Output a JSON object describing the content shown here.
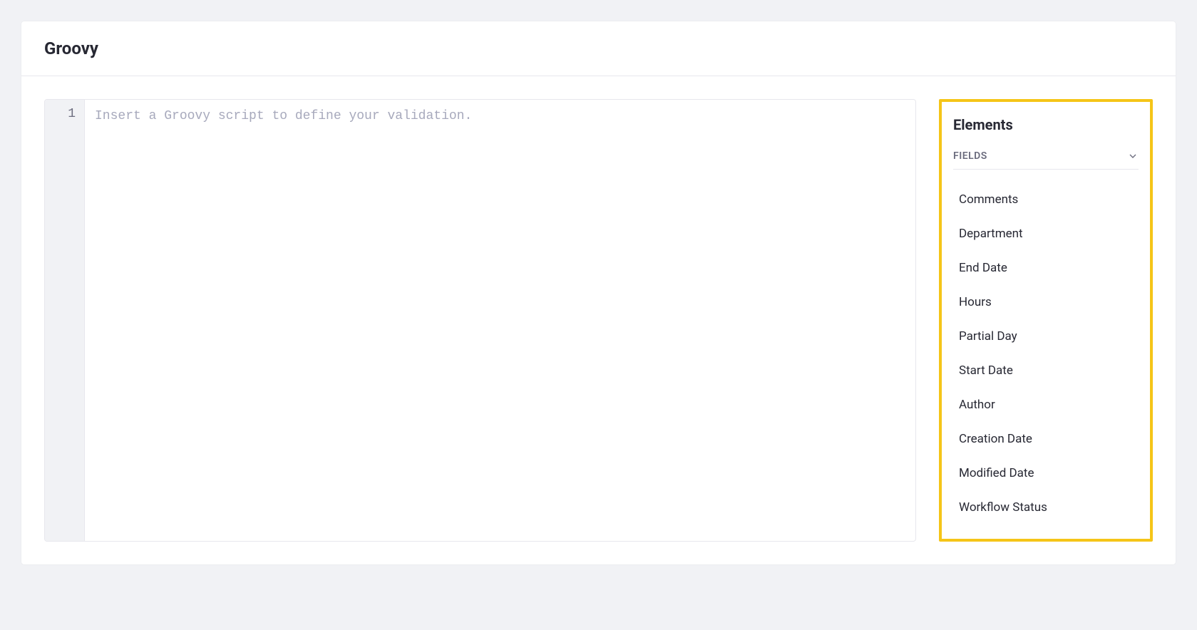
{
  "header": {
    "title": "Groovy"
  },
  "editor": {
    "line_number": "1",
    "placeholder": "Insert a Groovy script to define your validation.",
    "value": ""
  },
  "sidebar": {
    "title": "Elements",
    "section_label": "FIELDS",
    "fields": [
      "Comments",
      "Department",
      "End Date",
      "Hours",
      "Partial Day",
      "Start Date",
      "Author",
      "Creation Date",
      "Modified Date",
      "Workflow Status"
    ]
  }
}
